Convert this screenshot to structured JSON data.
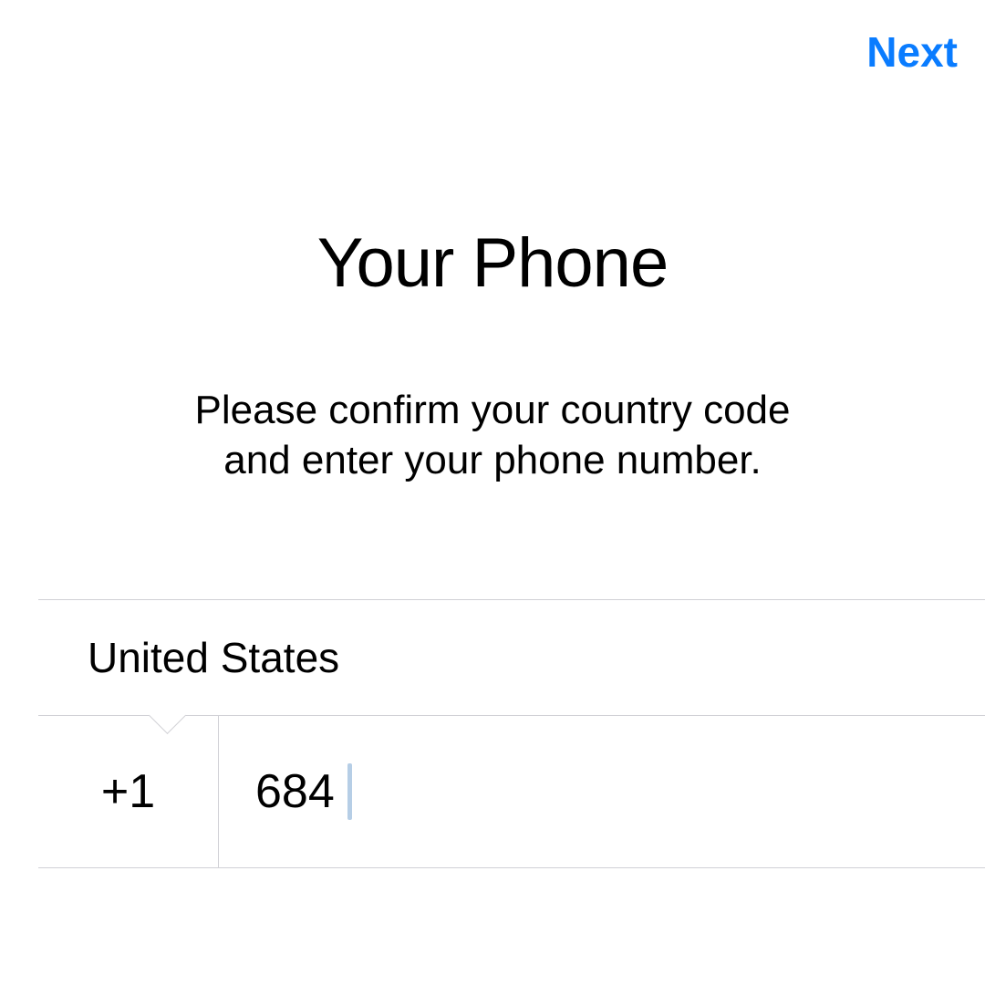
{
  "header": {
    "next_label": "Next"
  },
  "main": {
    "title": "Your Phone",
    "subtitle_line1": "Please confirm your country code",
    "subtitle_line2": "and enter your phone number."
  },
  "form": {
    "country": "United States",
    "country_code": "+1",
    "phone_value": "684"
  },
  "colors": {
    "accent": "#0a7cff",
    "separator": "#d1d1d6",
    "caret": "#b6cee6"
  }
}
